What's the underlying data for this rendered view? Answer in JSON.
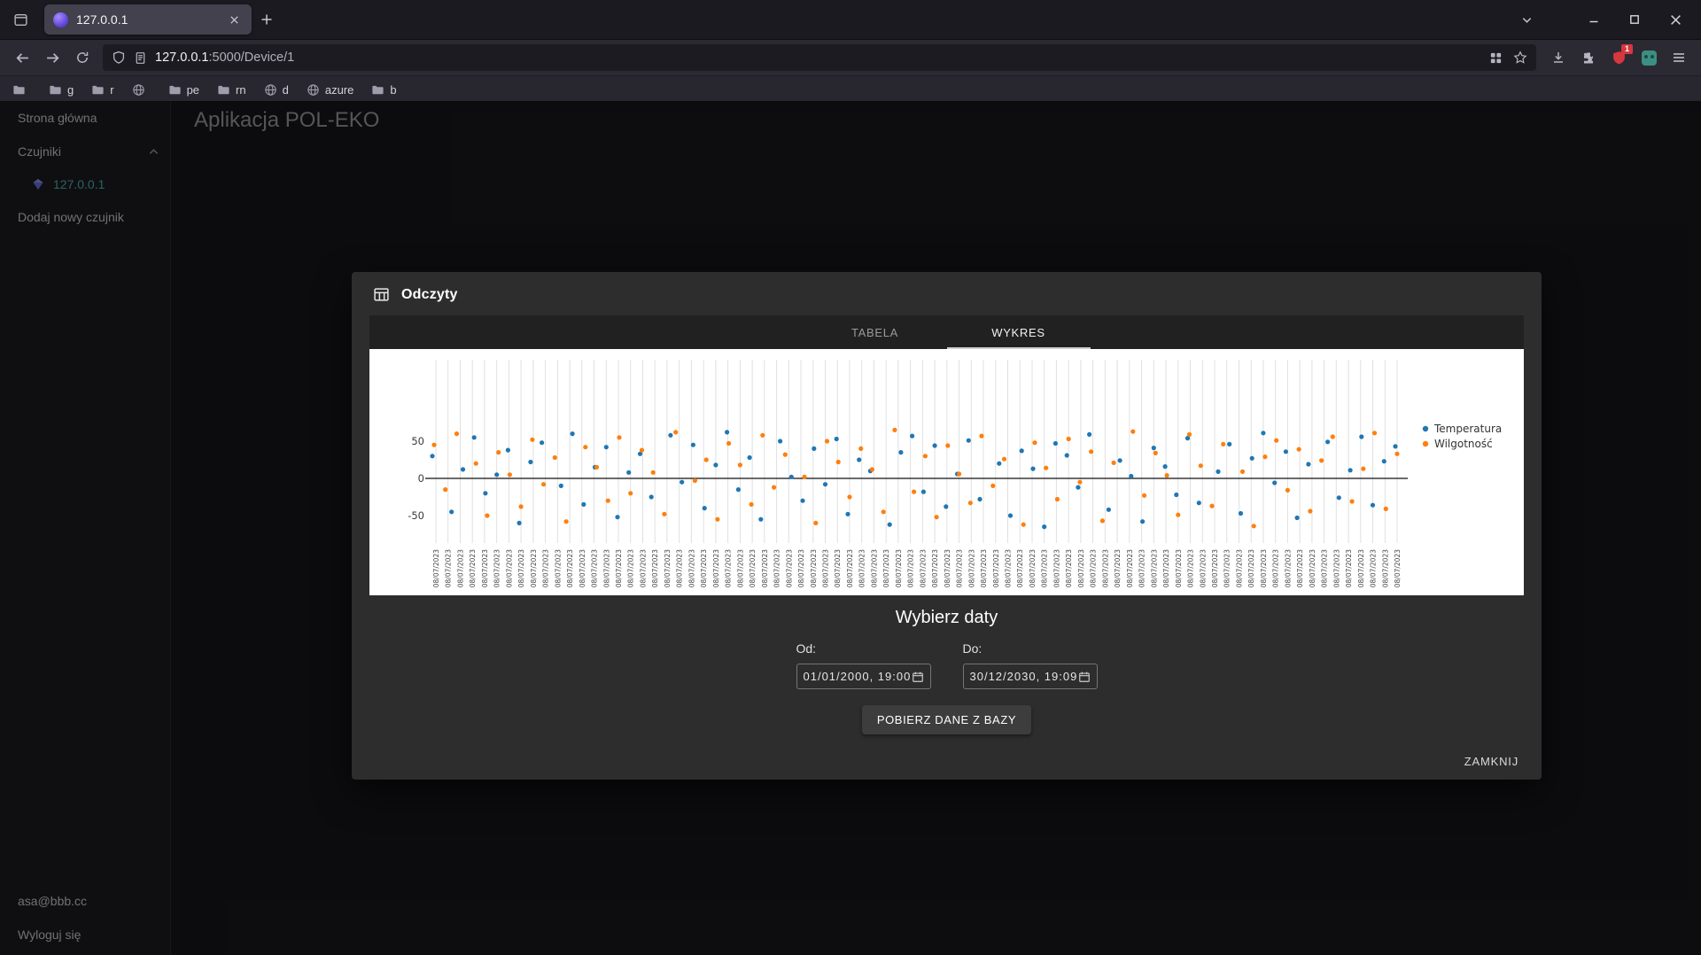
{
  "browser": {
    "tab_title": "127.0.0.1",
    "url_host": "127.0.0.1",
    "url_path": ":5000/Device/1",
    "extension_badge": "1",
    "bookmarks": [
      {
        "label": "",
        "icon": "folder"
      },
      {
        "label": "g",
        "icon": "folder"
      },
      {
        "label": "r",
        "icon": "folder"
      },
      {
        "label": "",
        "icon": "globe"
      },
      {
        "label": "pe",
        "icon": "folder"
      },
      {
        "label": "rn",
        "icon": "folder"
      },
      {
        "label": "d",
        "icon": "globe"
      },
      {
        "label": "azure",
        "icon": "globe"
      },
      {
        "label": "b",
        "icon": "folder"
      }
    ]
  },
  "page": {
    "app_title": "Aplikacja POL-EKO"
  },
  "sidebar": {
    "home": "Strona główna",
    "sensors_group": "Czujniki",
    "sensor_ip": "127.0.0.1",
    "add_sensor": "Dodaj nowy czujnik",
    "email": "asa@bbb.cc",
    "logout": "Wyloguj się"
  },
  "dialog": {
    "title": "Odczyty",
    "tab_table": "TABELA",
    "tab_chart": "WYKRES",
    "dates_heading": "Wybierz daty",
    "from_label": "Od:",
    "to_label": "Do:",
    "from_value": "01/01/2000, 19:00",
    "to_value": "30/12/2030, 19:09",
    "fetch_button": "POBIERZ DANE Z BAZY",
    "close_button": "ZAMKNIJ"
  },
  "chart_data": {
    "type": "scatter",
    "title": "",
    "xlabel": "",
    "ylabel": "",
    "x_tick_label": "08/07/2023",
    "n_points": 80,
    "ylim": [
      -80,
      80
    ],
    "yticks": [
      50,
      0,
      -50
    ],
    "grid": "vertical",
    "legend_position": "top-right",
    "series": [
      {
        "name": "Temperatura",
        "color": "#1f77b4",
        "values": [
          30,
          -45,
          12,
          55,
          -20,
          5,
          38,
          -60,
          22,
          48,
          -10,
          60,
          -35,
          15,
          42,
          -52,
          8,
          33,
          -25,
          58,
          -5,
          45,
          -40,
          18,
          62,
          -15,
          28,
          -55,
          50,
          2,
          -30,
          40,
          -8,
          53,
          -48,
          25,
          10,
          -62,
          35,
          57,
          -18,
          44,
          -38,
          6,
          51,
          -28,
          20,
          -50,
          37,
          13,
          -65,
          47,
          31,
          -12,
          59,
          -42,
          24,
          3,
          -58,
          41,
          16,
          -22,
          54,
          -33,
          9,
          46,
          -47,
          27,
          61,
          -6,
          36,
          -53,
          19,
          49,
          -26,
          11,
          56,
          -36,
          23,
          43
        ]
      },
      {
        "name": "Wilgotność",
        "color": "#ff7f0e",
        "values": [
          45,
          -15,
          60,
          20,
          -50,
          35,
          5,
          -38,
          52,
          -8,
          28,
          -58,
          42,
          15,
          -30,
          55,
          -20,
          38,
          8,
          -48,
          62,
          -3,
          25,
          -55,
          47,
          18,
          -35,
          58,
          -12,
          32,
          2,
          -60,
          50,
          22,
          -25,
          40,
          12,
          -45,
          65,
          -18,
          30,
          -52,
          44,
          6,
          -33,
          57,
          -10,
          26,
          -62,
          48,
          14,
          -28,
          53,
          -5,
          36,
          -57,
          21,
          63,
          -23,
          34,
          4,
          -49,
          59,
          17,
          -37,
          46,
          9,
          -64,
          29,
          51,
          -16,
          39,
          -44,
          24,
          56,
          -31,
          13,
          61,
          -41,
          33
        ]
      }
    ]
  }
}
